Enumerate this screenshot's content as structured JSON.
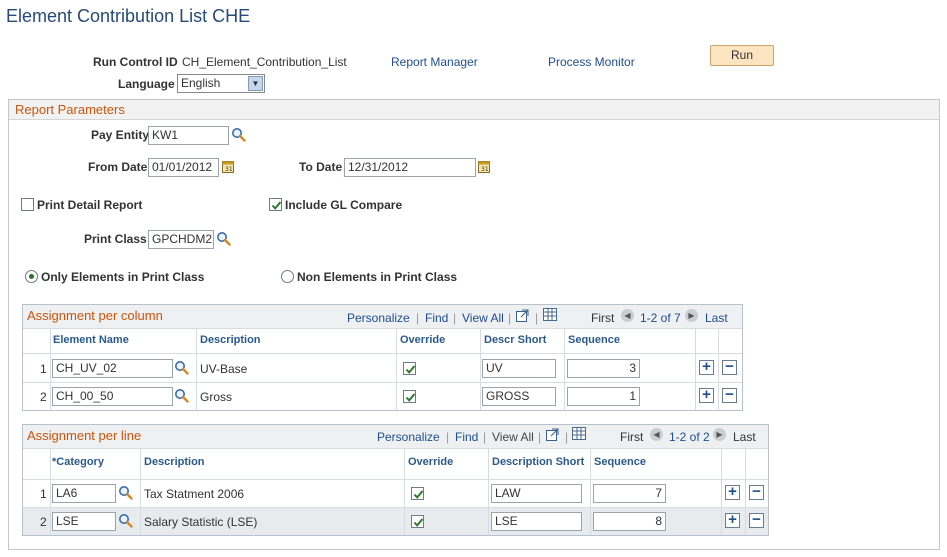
{
  "page": {
    "title": "Element Contribution List CHE"
  },
  "run_control": {
    "label": "Run Control ID",
    "value": "CH_Element_Contribution_List",
    "report_manager": "Report Manager",
    "process_monitor": "Process Monitor",
    "run_button": "Run",
    "language_label": "Language",
    "language_value": "English"
  },
  "report_parameters": {
    "title": "Report Parameters",
    "pay_entity_label": "Pay Entity",
    "pay_entity_value": "KW1",
    "from_date_label": "From Date",
    "from_date_value": "01/01/2012",
    "to_date_label": "To Date",
    "to_date_value": "12/31/2012",
    "print_detail_label": "Print Detail Report",
    "print_detail_checked": false,
    "include_gl_label": "Include GL Compare",
    "include_gl_checked": true,
    "print_class_label": "Print Class",
    "print_class_value": "GPCHDM2",
    "radio_only_label": "Only Elements in Print Class",
    "radio_non_label": "Non Elements in Print Class",
    "radio_selected": "only"
  },
  "grid_column": {
    "title": "Assignment per column",
    "personalize": "Personalize",
    "find": "Find",
    "view_all": "View All",
    "first": "First",
    "range": "1-2 of 7",
    "last": "Last",
    "headers": [
      "Element Name",
      "Description",
      "Override",
      "Descr Short",
      "Sequence"
    ],
    "rows": [
      {
        "num": "1",
        "element": "CH_UV_02",
        "description": "UV-Base",
        "override": true,
        "short": "UV",
        "sequence": "3"
      },
      {
        "num": "2",
        "element": "CH_00_50",
        "description": "Gross",
        "override": true,
        "short": "GROSS",
        "sequence": "1"
      }
    ]
  },
  "grid_line": {
    "title": "Assignment per line",
    "personalize": "Personalize",
    "find": "Find",
    "view_all": "View All",
    "first": "First",
    "range": "1-2 of 2",
    "last": "Last",
    "headers": [
      "*Category",
      "Description",
      "Override",
      "Description Short",
      "Sequence"
    ],
    "rows": [
      {
        "num": "1",
        "category": "LA6",
        "description": "Tax Statment 2006",
        "override": true,
        "short": "LAW",
        "sequence": "7"
      },
      {
        "num": "2",
        "category": "LSE",
        "description": "Salary Statistic (LSE)",
        "override": true,
        "short": "LSE",
        "sequence": "8"
      }
    ]
  },
  "colors": {
    "title": "#274a78",
    "link": "#1f4e8c",
    "section_title": "#c8550d",
    "run_button": "#fce4c0",
    "selected_row": "#e8ebee"
  }
}
